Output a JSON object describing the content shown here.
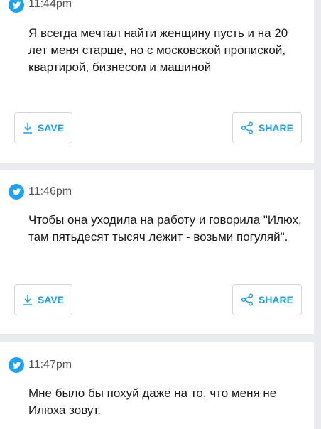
{
  "colors": {
    "accent": "#1da1f2",
    "background": "#e9ebee"
  },
  "tweets": [
    {
      "time": "11:44pm",
      "text": "Я всегда мечтал найти женщину пусть и на 20 лет меня старше, но с московской пропиской,  квартирой,  бизнесом и машиной"
    },
    {
      "time": "11:46pm",
      "text": "Чтобы она уходила на работу и говорила \"Илюх, там пятьдесят тысяч лежит - возьми погуляй\"."
    },
    {
      "time": "11:47pm",
      "text": "Мне было бы похуй даже на то,  что меня не Илюха зовут."
    }
  ],
  "actions": {
    "save_label": "SAVE",
    "share_label": "SHARE"
  },
  "icons": {
    "badge": "twitter-bird-icon",
    "save": "download-icon",
    "share": "share-icon"
  }
}
